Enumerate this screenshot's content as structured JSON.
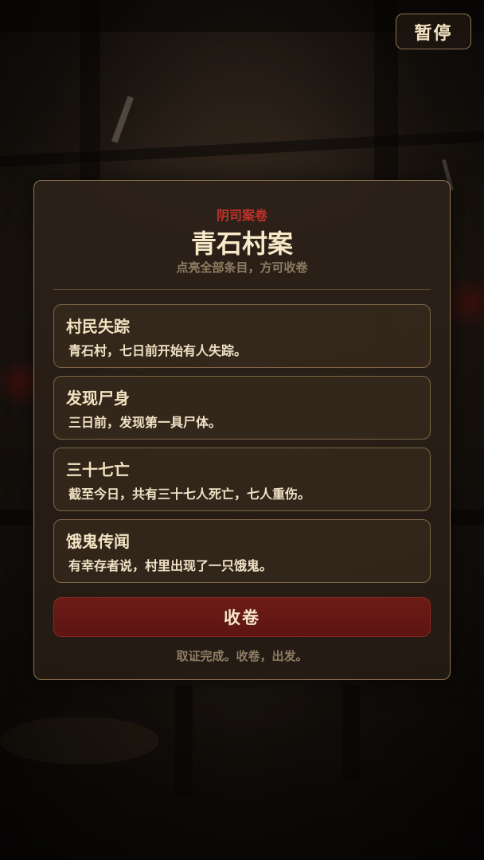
{
  "hud": {
    "pause_label": "暂停"
  },
  "case": {
    "category": "阴司案卷",
    "title": "青石村案",
    "hint": "点亮全部条目，方可收卷",
    "entries": [
      {
        "title": "村民失踪",
        "desc": "青石村，七日前开始有人失踪。"
      },
      {
        "title": "发现尸身",
        "desc": "三日前，发现第一具尸体。"
      },
      {
        "title": "三十七亡",
        "desc": "截至今日，共有三十七人死亡，七人重伤。"
      },
      {
        "title": "饿鬼传闻",
        "desc": "有幸存者说，村里出现了一只饿鬼。"
      }
    ],
    "close_label": "收卷",
    "footer": "取证完成。收卷，出发。"
  },
  "colors": {
    "accent_red": "#c0322a",
    "button_red": "#6e1b17",
    "panel_border": "#8f7650",
    "text_light": "#f2e3c2"
  }
}
